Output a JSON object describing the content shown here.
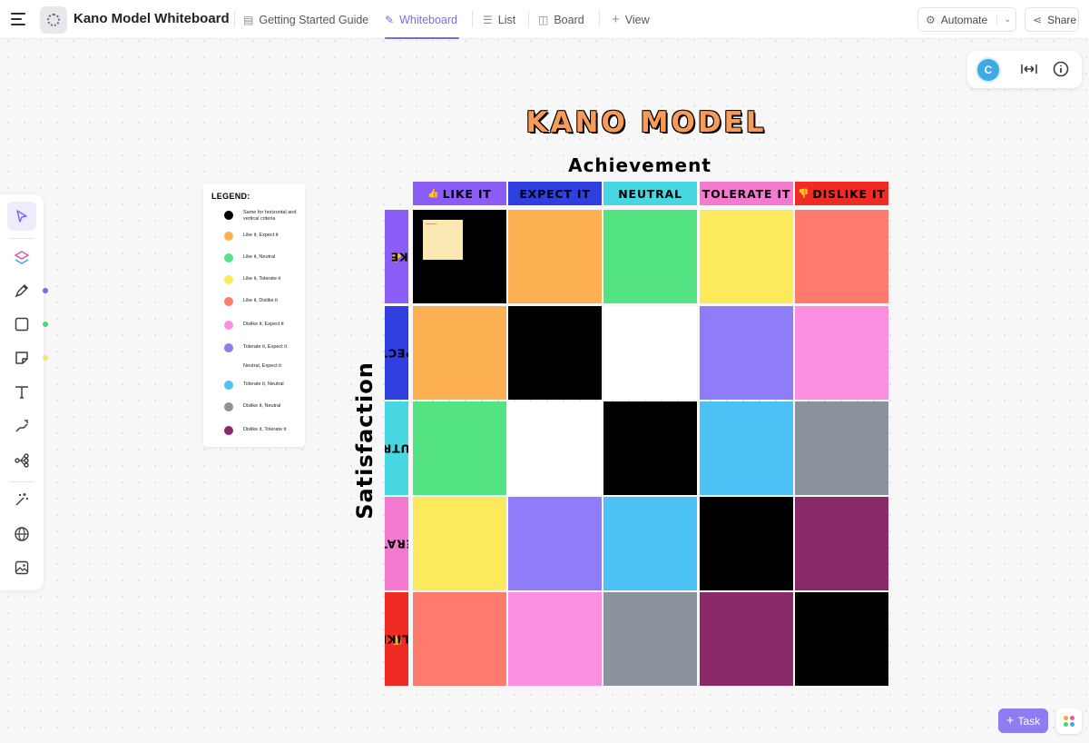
{
  "header": {
    "doc_title": "Kano Model Whiteboard",
    "tabs": [
      {
        "label": "Getting Started Guide",
        "icon": "document-icon"
      },
      {
        "label": "Whiteboard",
        "icon": "whiteboard-icon",
        "active": true
      },
      {
        "label": "List",
        "icon": "list-icon"
      },
      {
        "label": "Board",
        "icon": "board-icon"
      },
      {
        "label": "View",
        "icon": "plus-icon"
      }
    ],
    "automate_label": "Automate",
    "share_label": "Share"
  },
  "utility": {
    "avatar_initial": "C"
  },
  "toolbar": {
    "tools": [
      "select-tool-icon",
      "ai-brain-icon",
      "pen-icon",
      "shape-icon",
      "sticky-note-icon",
      "text-icon",
      "connector-icon",
      "mindmap-icon",
      "magic-icon",
      "globe-icon",
      "image-icon"
    ],
    "side_dot_colors": [
      "#7b68ee",
      "#4bd37a",
      "#f6e27a"
    ]
  },
  "board": {
    "title": "KANO MODEL",
    "x_axis_label": "Achievement",
    "y_axis_label": "Satisfaction",
    "columns": [
      {
        "label": "LIKE IT",
        "icon": "👍",
        "color": "#8b5cf6"
      },
      {
        "label": "EXPECT IT",
        "icon": "",
        "color": "#2f3fe0"
      },
      {
        "label": "NEUTRAL",
        "icon": "",
        "color": "#48d6e0"
      },
      {
        "label": "TOLERATE IT",
        "icon": "",
        "color": "#f47ad0"
      },
      {
        "label": "DISLIKE IT",
        "icon": "👎",
        "color": "#ef2b23"
      }
    ],
    "rows": [
      {
        "label": "LIKE IT",
        "icon": "👍",
        "color": "#8b5cf6"
      },
      {
        "label": "EXPECT IT",
        "icon": "",
        "color": "#2f3fe0"
      },
      {
        "label": "NEUTRAL",
        "icon": "",
        "color": "#48d6e0"
      },
      {
        "label": "TOLERATE IT",
        "icon": "",
        "color": "#f47ad0"
      },
      {
        "label": "DISLIKE IT",
        "icon": "👎",
        "color": "#ef2b23"
      }
    ],
    "grid_colors": [
      [
        "#000000",
        "#fdb052",
        "#54e382",
        "#fde95c",
        "#ff7b6e"
      ],
      [
        "#fdb052",
        "#000000",
        "#ffffff",
        "#8f7cf8",
        "#fd8fe3"
      ],
      [
        "#54e382",
        "#ffffff",
        "#000000",
        "#4bc1f5",
        "#8a939c"
      ],
      [
        "#fde95c",
        "#8f7cf8",
        "#4bc1f5",
        "#000000",
        "#8b2a68"
      ],
      [
        "#ff7b6e",
        "#fd8fe3",
        "#8a939c",
        "#8b2a68",
        "#000000"
      ]
    ]
  },
  "legend": {
    "title": "LEGEND:",
    "items": [
      {
        "label": "Same for horizontal and vertical criteria",
        "color": "#000000"
      },
      {
        "label": "Like it, Expect it",
        "color": "#fdb052"
      },
      {
        "label": "Like it, Neutral",
        "color": "#54e382"
      },
      {
        "label": "Like it, Tolerate it",
        "color": "#fde95c"
      },
      {
        "label": "Like it, Dislike it",
        "color": "#ff7b6e"
      },
      {
        "label": "Dislike it, Expect it",
        "color": "#fd8fe3"
      },
      {
        "label": "Tolerate it, Expect it",
        "color": "#8f7cf8"
      },
      {
        "label": "Neutral, Expect it",
        "color": "#ffffff"
      },
      {
        "label": "Tolerate it, Neutral",
        "color": "#4bc1f5"
      },
      {
        "label": "Dislike it, Neutral",
        "color": "#8a939c"
      },
      {
        "label": "Dislike it, Tolerate it",
        "color": "#8b2a68"
      }
    ]
  },
  "task_button": {
    "label": "Task"
  },
  "apps_dot_colors": [
    "#f3a83b",
    "#e05c9f",
    "#4bd37a",
    "#3fa9e6"
  ]
}
